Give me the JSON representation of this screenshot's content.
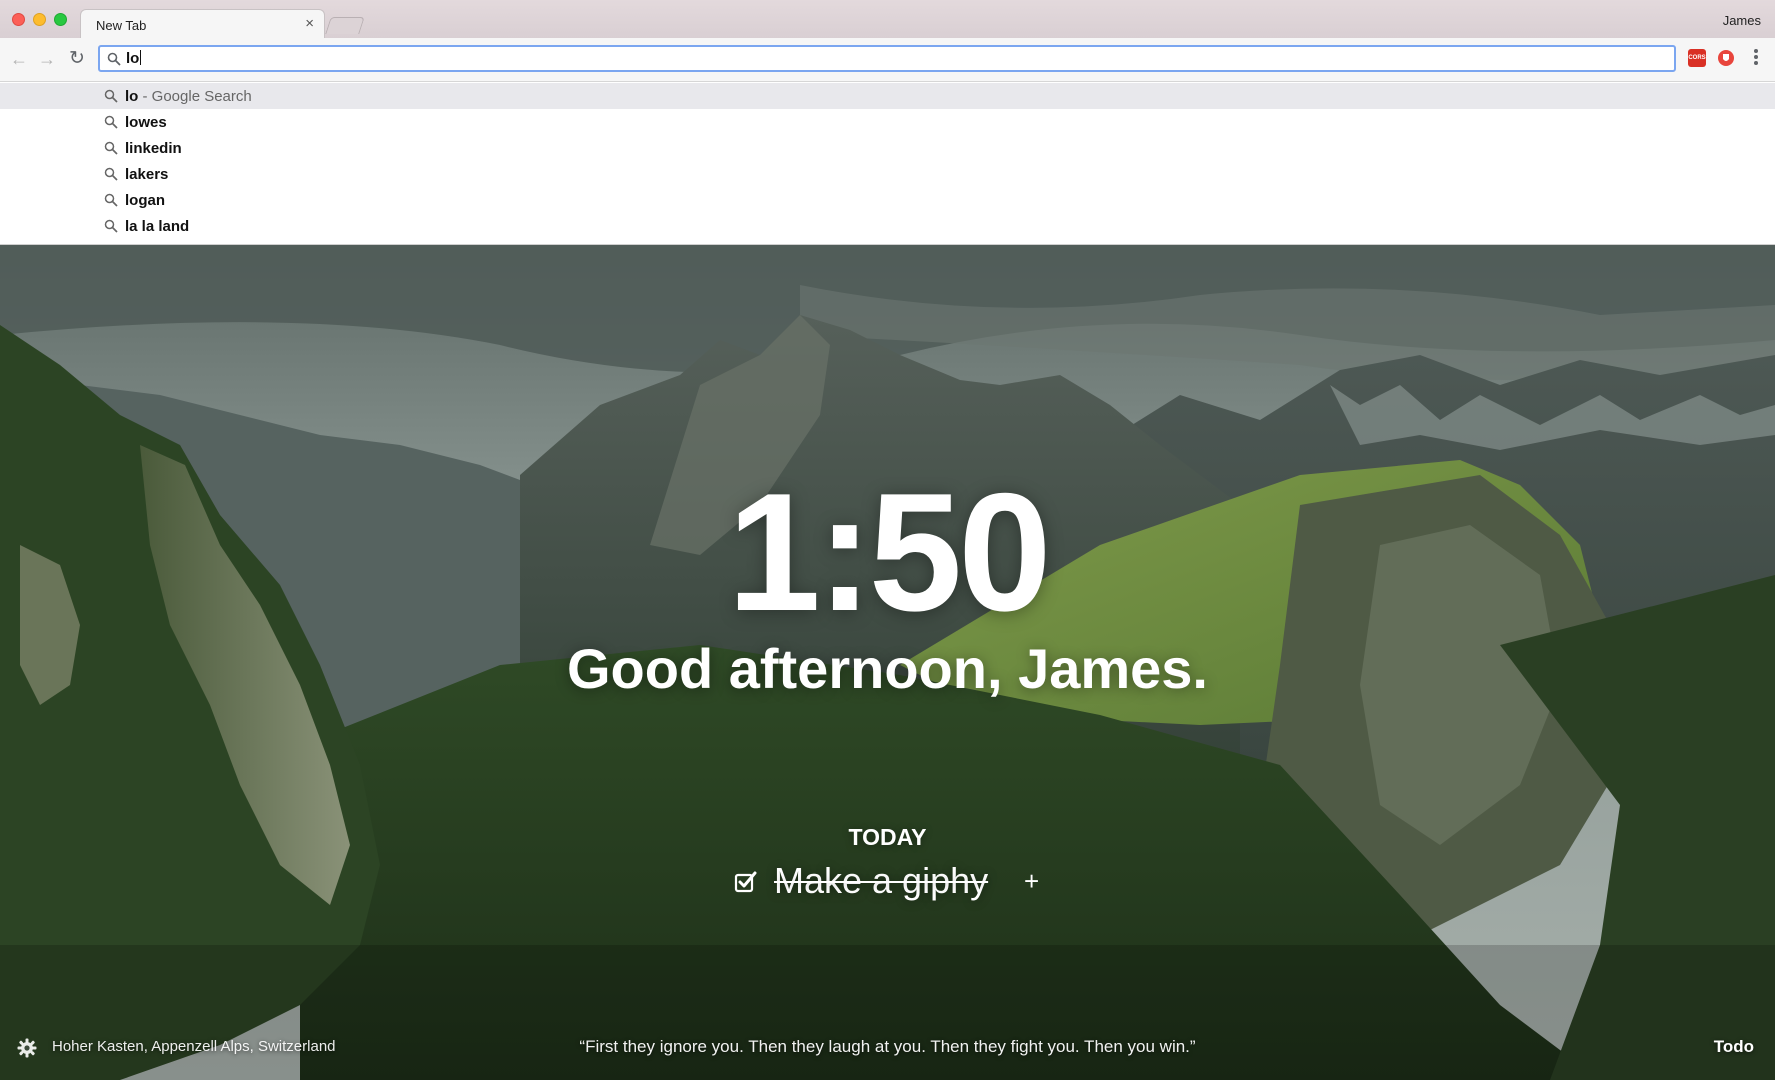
{
  "browser": {
    "tab_title": "New Tab",
    "tab_close": "×",
    "profile_name": "James",
    "back_label": "←",
    "forward_label": "→",
    "reload_label": "↻",
    "extension_label": "CORS"
  },
  "omnibox": {
    "query": "lo"
  },
  "suggestions": [
    {
      "text": "lo",
      "suffix": " - Google Search"
    },
    {
      "text": "lowes",
      "suffix": ""
    },
    {
      "text": "linkedin",
      "suffix": ""
    },
    {
      "text": "lakers",
      "suffix": ""
    },
    {
      "text": "logan",
      "suffix": ""
    },
    {
      "text": "la la land",
      "suffix": ""
    }
  ],
  "dashboard": {
    "time": "1:50",
    "greeting": "Good afternoon, James.",
    "focus_label": "TODAY",
    "focus_task": "Make a giphy",
    "add_label": "+",
    "location": "Hoher Kasten, Appenzell Alps, Switzerland",
    "quote": "“First they ignore you. Then they laugh at you. Then they fight you. Then you win.”",
    "todo_label": "Todo"
  },
  "icons": {
    "tab_close": "close-icon",
    "search": "search-icon",
    "back": "arrow-left-icon",
    "forward": "arrow-right-icon",
    "reload": "reload-icon",
    "menu": "more-vertical-icon",
    "settings": "gear-icon",
    "todo_check": "checked-checkbox-icon"
  }
}
